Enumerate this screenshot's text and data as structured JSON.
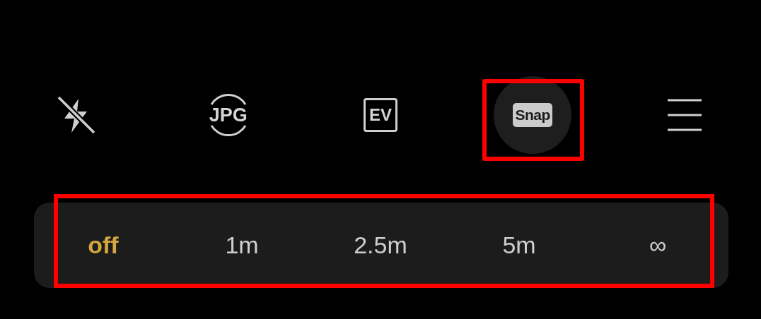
{
  "toolbar": [
    {
      "kind": "flash",
      "on": false,
      "selected": false,
      "highlighted": false
    },
    {
      "kind": "format",
      "label": "JPG",
      "selected": false,
      "highlighted": false
    },
    {
      "kind": "exposure",
      "label": "EV",
      "selected": false,
      "highlighted": false
    },
    {
      "kind": "mode",
      "label": "Snap",
      "selected": true,
      "highlighted": true
    },
    {
      "kind": "menu",
      "selected": false,
      "highlighted": false
    }
  ],
  "timer_bar": {
    "highlighted": true,
    "options": [
      {
        "label": "off",
        "selected": true
      },
      {
        "label": "1m",
        "selected": false
      },
      {
        "label": "2.5m",
        "selected": false
      },
      {
        "label": "5m",
        "selected": false
      },
      {
        "label": "∞",
        "selected": false
      }
    ]
  }
}
